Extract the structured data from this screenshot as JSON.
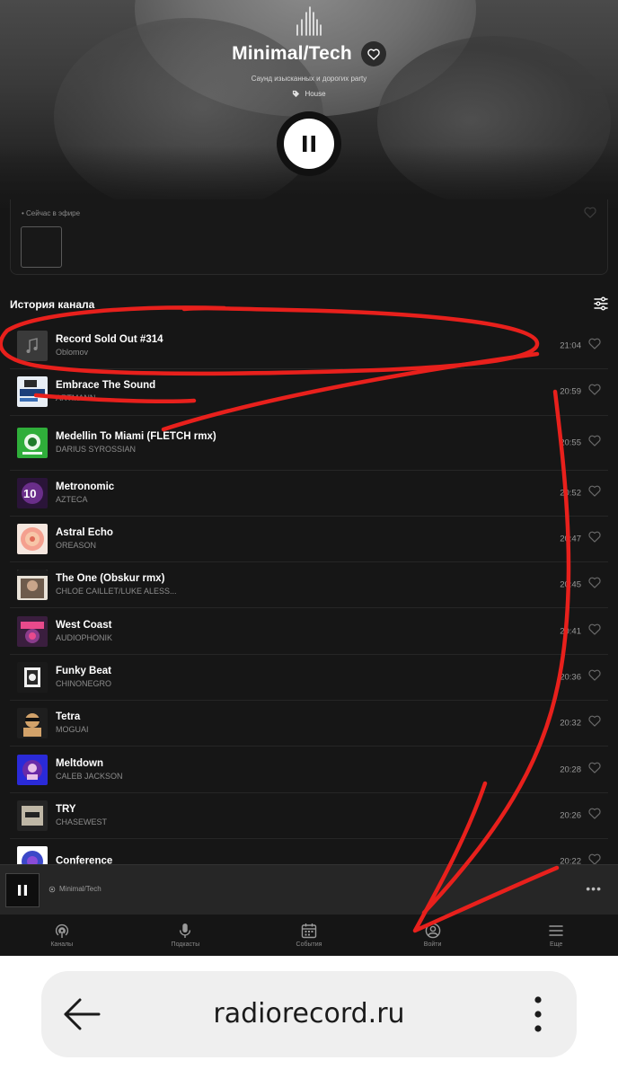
{
  "station": {
    "title": "Minimal/Tech",
    "subtitle": "Саунд изысканных и дорогих party",
    "genre": "House"
  },
  "onair": {
    "label": "• Сейчас в эфире"
  },
  "history": {
    "title": "История канала"
  },
  "tracks": [
    {
      "title": "Record Sold Out #314",
      "artist": "Oblomov",
      "time": "21:04",
      "cover": "note"
    },
    {
      "title": "Embrace The Sound",
      "artist": "ARTMANN",
      "time": "20:59",
      "cover": "c1"
    },
    {
      "title": "Medellin To Miami (FLETCH rmx)",
      "artist": "DARIUS SYROSSIAN",
      "time": "20:55",
      "cover": "c2"
    },
    {
      "title": "Metronomic",
      "artist": "AZTECA",
      "time": "20:52",
      "cover": "c3"
    },
    {
      "title": "Astral Echo",
      "artist": "OREASON",
      "time": "20:47",
      "cover": "c4"
    },
    {
      "title": "The One (Obskur rmx)",
      "artist": "CHLOE CAILLET/LUKE ALESS...",
      "time": "20:45",
      "cover": "c5"
    },
    {
      "title": "West Coast",
      "artist": "AUDIOPHONIK",
      "time": "20:41",
      "cover": "c6"
    },
    {
      "title": "Funky Beat",
      "artist": "CHINONEGRO",
      "time": "20:36",
      "cover": "c7"
    },
    {
      "title": "Tetra",
      "artist": "MOGUAI",
      "time": "20:32",
      "cover": "c8"
    },
    {
      "title": "Meltdown",
      "artist": "CALEB JACKSON",
      "time": "20:28",
      "cover": "c9"
    },
    {
      "title": "TRY",
      "artist": "CHASEWEST",
      "time": "20:26",
      "cover": "c10"
    },
    {
      "title": "Conference",
      "artist": "",
      "time": "20:22",
      "cover": "c11"
    }
  ],
  "mini_player": {
    "station": "Minimal/Tech"
  },
  "nav": [
    {
      "label": "Каналы",
      "icon": "radio-icon"
    },
    {
      "label": "Подкасты",
      "icon": "microphone-icon"
    },
    {
      "label": "События",
      "icon": "calendar-icon"
    },
    {
      "label": "Войти",
      "icon": "user-icon"
    },
    {
      "label": "Еще",
      "icon": "menu-icon"
    }
  ],
  "browser": {
    "url": "radiorecord.ru"
  },
  "colors": {
    "background": "#161616",
    "annotation": "#e8201c",
    "accent_white": "#ffffff"
  }
}
